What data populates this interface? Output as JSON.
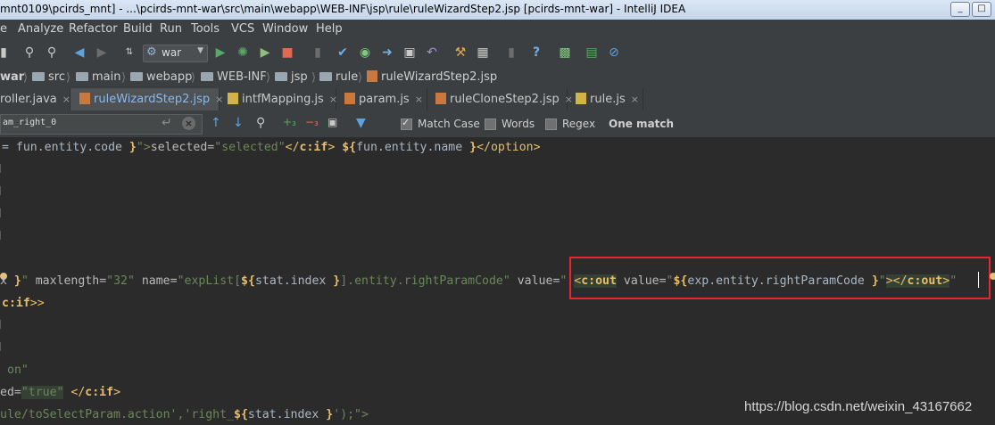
{
  "window": {
    "title": "mnt0109\\pcirds_mnt] - ...\\pcirds-mnt-war\\src\\main\\webapp\\WEB-INF\\jsp\\rule\\ruleWizardStep2.jsp [pcirds-mnt-war] - IntelliJ IDEA",
    "minimize": "_",
    "restore": "□",
    "close": "X"
  },
  "menu": [
    "e",
    "Analyze",
    "Refactor",
    "Build",
    "Run",
    "Tools",
    "VCS",
    "Window",
    "Help"
  ],
  "toolbar": {
    "run_config": "war"
  },
  "breadcrumbs": [
    "war",
    "src",
    "main",
    "webapp",
    "WEB-INF",
    "jsp",
    "rule",
    "ruleWizardStep2.jsp"
  ],
  "tabs": [
    {
      "label": "roller.java",
      "close": "×"
    },
    {
      "label": "ruleWizardStep2.jsp",
      "close": "×"
    },
    {
      "label": "intfMapping.js",
      "close": "×"
    },
    {
      "label": "param.js",
      "close": "×"
    },
    {
      "label": "ruleCloneStep2.jsp",
      "close": "×"
    },
    {
      "label": "rule.js",
      "close": "×"
    }
  ],
  "find": {
    "value": "am_right_0",
    "match_case_label": "Match Case",
    "match_case_checked": true,
    "words_label": "Words",
    "words_checked": false,
    "regex_label": "Regex",
    "regex_checked": false,
    "result": "One match"
  },
  "code": {
    "l1": {
      "a": "= fun.entity.code ",
      "b": "}",
      "c": "\">",
      "d": "selected",
      "e": "=",
      "f": "\"selected\"",
      "g": "</",
      "h": "c:if",
      "i": "> ",
      "j": "${",
      "k": "fun.entity.name ",
      "l": "}",
      "m": "</",
      "n": "option",
      "o": ">"
    },
    "l7": {
      "a": "x ",
      "b": "}",
      "c": "\" ",
      "d": "maxlength",
      "e": "=",
      "f": "\"32\" ",
      "g": "name",
      "h": "=",
      "i": "\"expList[",
      "j": "${",
      "k": "stat.index ",
      "l": "}",
      "m": "].entity.rightParamCode\" ",
      "n": "value",
      "o": "=",
      "p": "\" ",
      "q": "<",
      "r": "c:out",
      "s": " value",
      "t": "=",
      "u": "\"",
      "v": "${",
      "w": "exp.entity.rightParamCode ",
      "x": "}",
      "y": "\"",
      "z": "></",
      "aa": "c:out",
      "ab": ">",
      "ac": "\""
    },
    "l8": {
      "a": "c:if",
      "b": ">>"
    },
    "l11": {
      "a": "on\""
    },
    "l12": {
      "a": "ed=",
      "b": "\"true\"",
      "c": " </",
      "d": "c:if",
      "e": ">"
    },
    "l13": {
      "a": "ule/toSelectParam.action','right_",
      "b": "${",
      "c": "stat.index ",
      "d": "}",
      "e": "');\">"
    }
  },
  "watermark": "https://blog.csdn.net/weixin_43167662"
}
